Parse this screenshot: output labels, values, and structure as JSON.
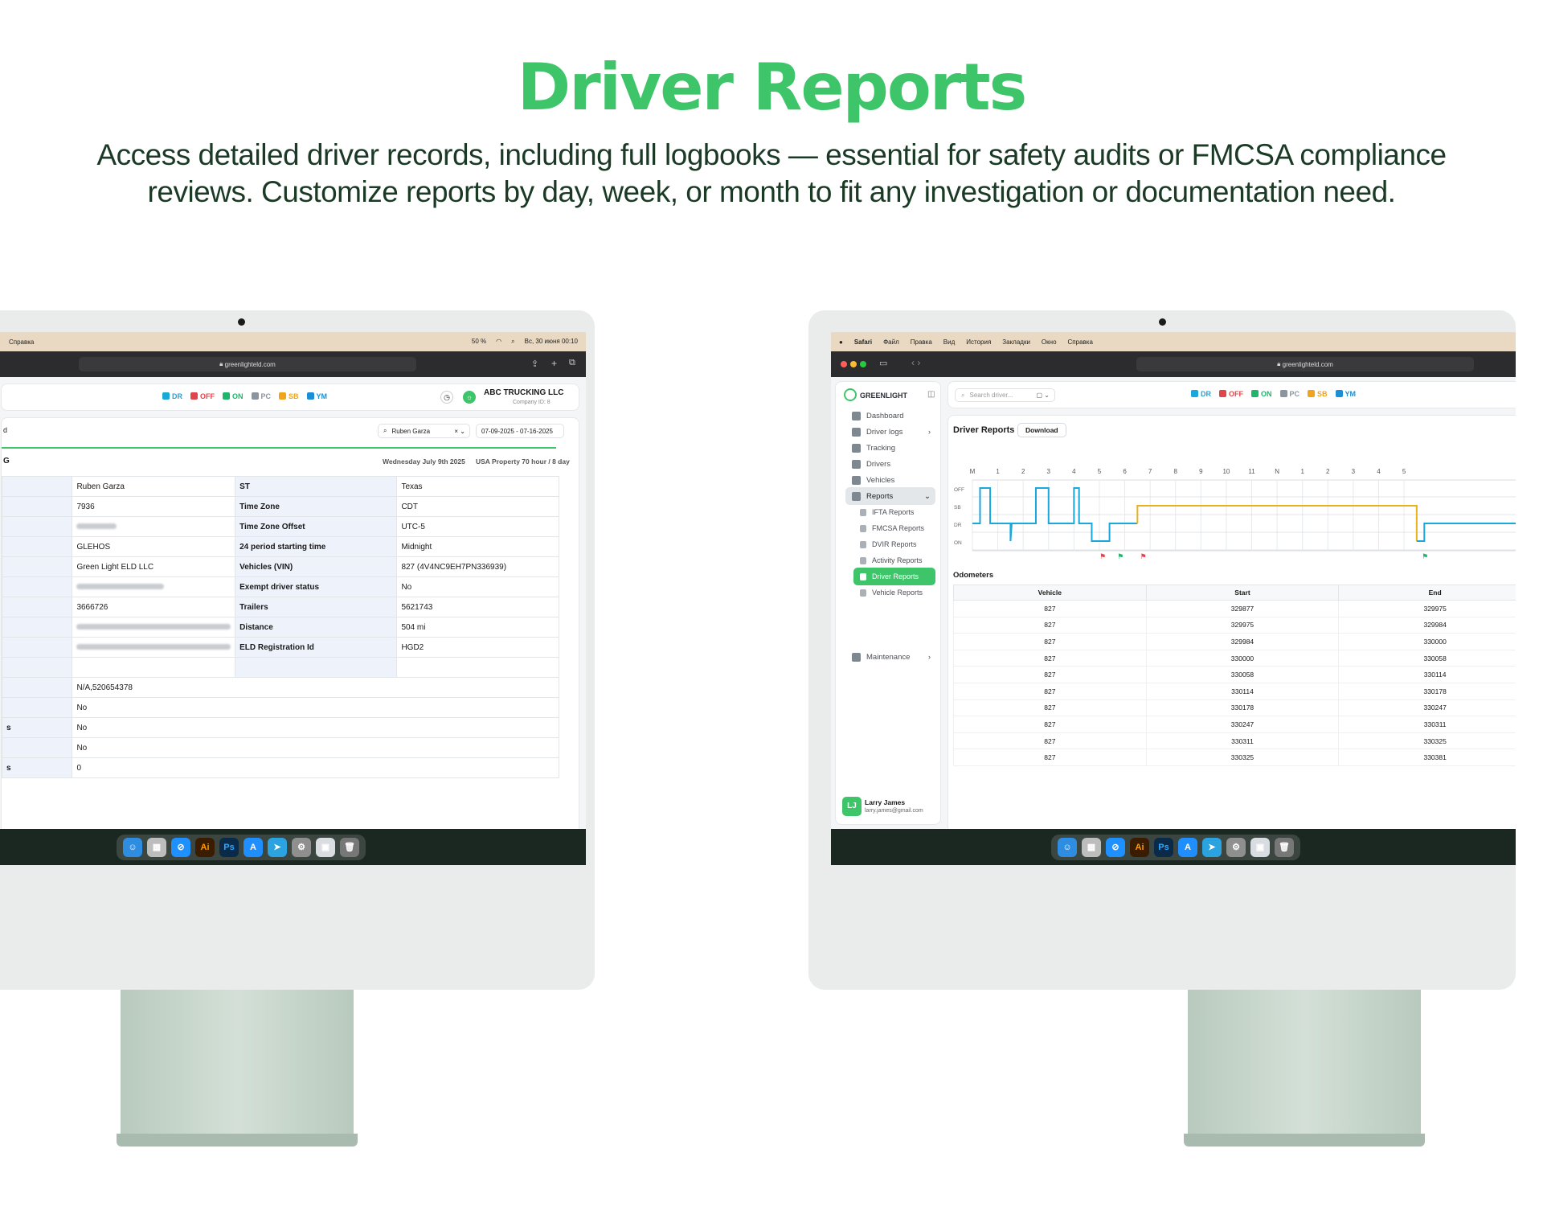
{
  "hero": {
    "title": "Driver Reports",
    "subtitle": "Access detailed driver records, including full logbooks — essential for safety audits or FMCSA compliance reviews. Customize reports by day, week, or month to fit any investigation or documentation need."
  },
  "colors": {
    "accent": "#3ec56a",
    "dr": "#1aa7d9",
    "off": "#e0454b",
    "on": "#1fb56a",
    "pc": "#8b95a1",
    "sb": "#f0a31c",
    "ym": "#1a8fd6"
  },
  "status_pills": [
    {
      "code": "DR",
      "color": "#1aa7d9"
    },
    {
      "code": "OFF",
      "color": "#e0454b"
    },
    {
      "code": "ON",
      "color": "#1fb56a"
    },
    {
      "code": "PC",
      "color": "#8b95a1"
    },
    {
      "code": "SB",
      "color": "#f0a31c"
    },
    {
      "code": "YM",
      "color": "#1a8fd6"
    }
  ],
  "left": {
    "menubar": {
      "app": "Справка",
      "datetime": "Вс, 30 июня 00:10",
      "battery": "50 %"
    },
    "url": "greenlighteld.com",
    "company": {
      "name": "ABC TRUCKING LLC",
      "id": "Company ID: 8"
    },
    "filter": {
      "driver": "Ruben Garza",
      "date_range": "07-09-2025 - 07-16-2025",
      "tab_fragment": "d"
    },
    "report": {
      "title_fragment": "G",
      "date": "Wednesday July 9th 2025",
      "cycle": "USA Property 70 hour / 8 day"
    },
    "rows": [
      {
        "v1": "Ruben Garza",
        "l2": "ST",
        "v2": "Texas"
      },
      {
        "v1": "7936",
        "l2": "Time Zone",
        "v2": "CDT"
      },
      {
        "v1": "",
        "l2": "Time Zone Offset",
        "v2": "UTC-5",
        "blur": 60
      },
      {
        "v1": "GLEHOS",
        "l2": "24 period starting time",
        "v2": "Midnight"
      },
      {
        "v1": "Green Light ELD LLC",
        "l2": "Vehicles (VIN)",
        "v2": "827 (4V4NC9EH7PN336939)"
      },
      {
        "v1": "",
        "l2": "Exempt driver status",
        "v2": "No",
        "blur": 130
      },
      {
        "v1": "3666726",
        "l2": "Trailers",
        "v2": "5621743"
      },
      {
        "v1": "",
        "l2": "Distance",
        "v2": "504 mi",
        "blur": 230
      },
      {
        "v1": "",
        "l2": "ELD Registration Id",
        "v2": "HGD2",
        "blur": 230
      },
      {
        "v1": "",
        "l2": "",
        "v2": ""
      }
    ],
    "rows_full": [
      {
        "frag": "",
        "v": "N/A,520654378"
      },
      {
        "frag": "",
        "v": "No"
      },
      {
        "frag": "s",
        "v": "No"
      },
      {
        "frag": "",
        "v": "No"
      },
      {
        "frag": "s",
        "v": "0"
      }
    ]
  },
  "right": {
    "menubar": {
      "apple": "",
      "items": [
        "Safari",
        "Файл",
        "Правка",
        "Вид",
        "История",
        "Закладки",
        "Окно",
        "Справка"
      ]
    },
    "url": "greenlighteld.com",
    "brand": "GREENLIGHT",
    "search_placeholder": "Search driver...",
    "sidebar": [
      {
        "label": "Dashboard"
      },
      {
        "label": "Driver logs",
        "chev": "›"
      },
      {
        "label": "Tracking"
      },
      {
        "label": "Drivers"
      },
      {
        "label": "Vehicles"
      },
      {
        "label": "Reports",
        "chev": "⌄"
      }
    ],
    "sub_items": [
      {
        "label": "IFTA Reports"
      },
      {
        "label": "FMCSA Reports"
      },
      {
        "label": "DVIR Reports"
      },
      {
        "label": "Activity Reports"
      },
      {
        "label": "Driver Reports",
        "active": true
      },
      {
        "label": "Vehicle Reports"
      }
    ],
    "maintenance": {
      "label": "Maintenance",
      "chev": "›"
    },
    "user": {
      "initials": "LJ",
      "name": "Larry James",
      "email": "larry.james@gmail.com"
    },
    "page_title": "Driver Reports",
    "download": "Download",
    "hours": [
      "M",
      "1",
      "2",
      "3",
      "4",
      "5",
      "6",
      "7",
      "8",
      "9",
      "10",
      "11",
      "N",
      "1",
      "2",
      "3",
      "4",
      "5"
    ],
    "statuses": [
      "OFF",
      "SB",
      "DR",
      "ON"
    ],
    "odometers": {
      "title": "Odometers",
      "headers": [
        "Vehicle",
        "Start",
        "End"
      ],
      "rows": [
        [
          "827",
          "329877",
          "329975"
        ],
        [
          "827",
          "329975",
          "329984"
        ],
        [
          "827",
          "329984",
          "330000"
        ],
        [
          "827",
          "330000",
          "330058"
        ],
        [
          "827",
          "330058",
          "330114"
        ],
        [
          "827",
          "330114",
          "330178"
        ],
        [
          "827",
          "330178",
          "330247"
        ],
        [
          "827",
          "330247",
          "330311"
        ],
        [
          "827",
          "330311",
          "330325"
        ],
        [
          "827",
          "330325",
          "330381"
        ]
      ]
    }
  }
}
